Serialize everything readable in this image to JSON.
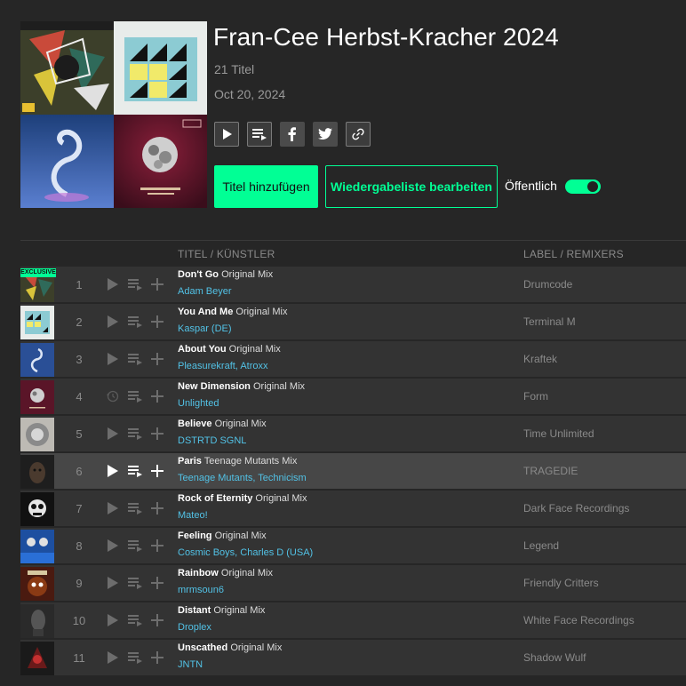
{
  "playlist": {
    "title": "Fran-Cee Herbst-Kracher 2024",
    "track_count": "21 Titel",
    "date": "Oct 20, 2024",
    "add_tracks_label": "Titel hinzufügen",
    "edit_playlist_label": "Wiedergabeliste bearbeiten",
    "public_label": "Öffentlich",
    "public_enabled": true
  },
  "icons": [
    "play-icon",
    "add-to-queue-icon",
    "facebook-icon",
    "twitter-icon",
    "link-icon"
  ],
  "table": {
    "col_title": "TITEL / KÜNSTLER",
    "col_label": "LABEL / REMIXERS",
    "exclusive_badge": "EXCLUSIVE",
    "rows": [
      {
        "num": "1",
        "title": "Don't Go",
        "mix": "Original Mix",
        "artists": "Adam Beyer",
        "label": "Drumcode",
        "exclusive": true,
        "active": false,
        "play_icon": "play"
      },
      {
        "num": "2",
        "title": "You And Me",
        "mix": "Original Mix",
        "artists": "Kaspar (DE)",
        "label": "Terminal M",
        "exclusive": false,
        "active": false,
        "play_icon": "play"
      },
      {
        "num": "3",
        "title": "About You",
        "mix": "Original Mix",
        "artists": "Pleasurekraft, Atroxx",
        "label": "Kraftek",
        "exclusive": false,
        "active": false,
        "play_icon": "play"
      },
      {
        "num": "4",
        "title": "New Dimension",
        "mix": "Original Mix",
        "artists": "Unlighted",
        "label": "Form",
        "exclusive": false,
        "active": false,
        "play_icon": "history"
      },
      {
        "num": "5",
        "title": "Believe",
        "mix": "Original Mix",
        "artists": "DSTRTD SGNL",
        "label": "Time Unlimited",
        "exclusive": false,
        "active": false,
        "play_icon": "play"
      },
      {
        "num": "6",
        "title": "Paris",
        "mix": "Teenage Mutants Mix",
        "artists": "Teenage Mutants, Technicism",
        "label": "TRAGEDIE",
        "exclusive": false,
        "active": true,
        "play_icon": "play"
      },
      {
        "num": "7",
        "title": "Rock of Eternity",
        "mix": "Original Mix",
        "artists": "Mateo!",
        "label": "Dark Face Recordings",
        "exclusive": false,
        "active": false,
        "play_icon": "play"
      },
      {
        "num": "8",
        "title": "Feeling",
        "mix": "Original Mix",
        "artists": "Cosmic Boys, Charles D (USA)",
        "label": "Legend",
        "exclusive": false,
        "active": false,
        "play_icon": "play"
      },
      {
        "num": "9",
        "title": "Rainbow",
        "mix": "Original Mix",
        "artists": "mrmsoun6",
        "label": "Friendly Critters",
        "exclusive": false,
        "active": false,
        "play_icon": "play"
      },
      {
        "num": "10",
        "title": "Distant",
        "mix": "Original Mix",
        "artists": "Droplex",
        "label": "White Face Recordings",
        "exclusive": false,
        "active": false,
        "play_icon": "play"
      },
      {
        "num": "11",
        "title": "Unscathed",
        "mix": "Original Mix",
        "artists": "JNTN",
        "label": "Shadow Wulf",
        "exclusive": false,
        "active": false,
        "play_icon": "play"
      }
    ]
  },
  "colors": {
    "accent": "#01ff95",
    "artist_link": "#52c2e6",
    "background": "#262626",
    "row": "#333333",
    "row_active": "#474747"
  }
}
